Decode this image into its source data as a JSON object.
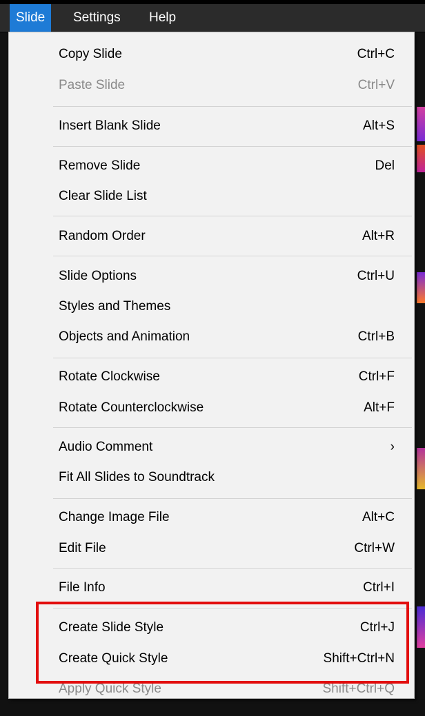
{
  "menubar": {
    "items": [
      {
        "label": "Slide",
        "active": true
      },
      {
        "label": "Settings",
        "active": false
      },
      {
        "label": "Help",
        "active": false
      }
    ]
  },
  "dropdown": {
    "items": [
      {
        "label": "Copy Slide",
        "shortcut": "Ctrl+C",
        "enabled": true
      },
      {
        "label": "Paste Slide",
        "shortcut": "Ctrl+V",
        "enabled": false
      },
      {
        "label": "Insert Blank Slide",
        "shortcut": "Alt+S",
        "enabled": true
      },
      {
        "label": "Remove Slide",
        "shortcut": "Del",
        "enabled": true
      },
      {
        "label": "Clear Slide List",
        "shortcut": "",
        "enabled": true
      },
      {
        "label": "Random Order",
        "shortcut": "Alt+R",
        "enabled": true
      },
      {
        "label": "Slide Options",
        "shortcut": "Ctrl+U",
        "enabled": true
      },
      {
        "label": "Styles and Themes",
        "shortcut": "",
        "enabled": true
      },
      {
        "label": "Objects and Animation",
        "shortcut": "Ctrl+B",
        "enabled": true
      },
      {
        "label": "Rotate Clockwise",
        "shortcut": "Ctrl+F",
        "enabled": true
      },
      {
        "label": "Rotate Counterclockwise",
        "shortcut": "Alt+F",
        "enabled": true
      },
      {
        "label": "Audio Comment",
        "shortcut": "›",
        "enabled": true,
        "submenu": true
      },
      {
        "label": "Fit All Slides to Soundtrack",
        "shortcut": "",
        "enabled": true
      },
      {
        "label": "Change Image File",
        "shortcut": "Alt+C",
        "enabled": true
      },
      {
        "label": "Edit File",
        "shortcut": "Ctrl+W",
        "enabled": true
      },
      {
        "label": "File Info",
        "shortcut": "Ctrl+I",
        "enabled": true
      },
      {
        "label": "Create Slide Style",
        "shortcut": "Ctrl+J",
        "enabled": true
      },
      {
        "label": "Create Quick Style",
        "shortcut": "Shift+Ctrl+N",
        "enabled": true
      },
      {
        "label": "Apply Quick Style",
        "shortcut": "Shift+Ctrl+Q",
        "enabled": false
      }
    ]
  },
  "colors": {
    "menubar_bg": "#2b2b2b",
    "active_menu": "#1e7bd6",
    "dropdown_bg": "#f2f2f2",
    "disabled_text": "#8a8a8a",
    "highlight_box": "#e20c0c"
  }
}
